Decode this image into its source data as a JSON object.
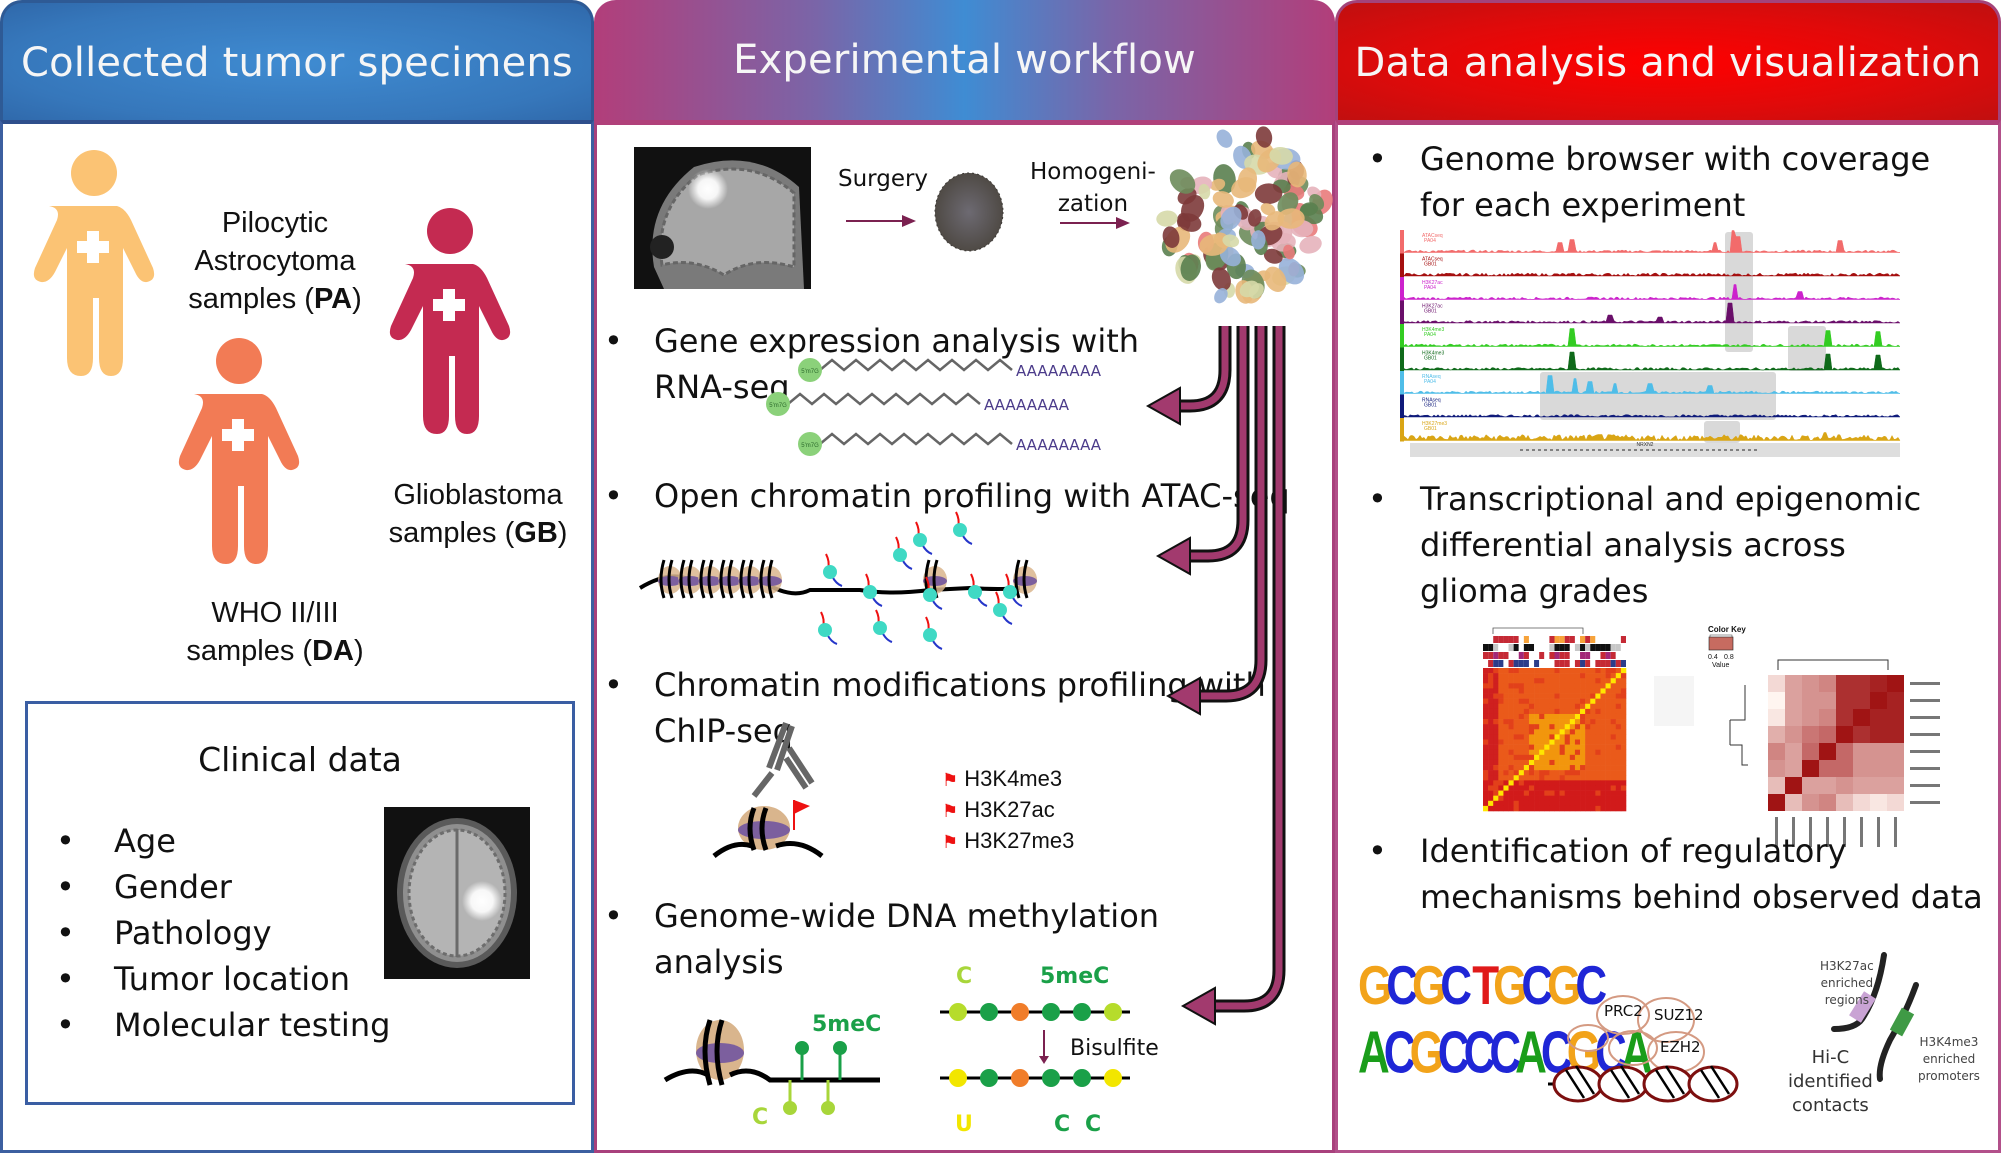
{
  "panels": {
    "specimens": {
      "title": "Collected tumor specimens",
      "groups": [
        {
          "line1": "Pilocytic",
          "line2": "Astrocytoma",
          "line3_prefix": "samples (",
          "code": "PA",
          "line3_suffix": ")",
          "color": "#fbc374"
        },
        {
          "line1": "WHO II/III",
          "line2_prefix": "samples (",
          "code": "DA",
          "line2_suffix": ")",
          "color": "#f27b55"
        },
        {
          "line1": "Glioblastoma",
          "line2_prefix": "samples (",
          "code": "GB",
          "line2_suffix": ")",
          "color": "#c42a51"
        }
      ],
      "clinical": {
        "title": "Clinical data",
        "bullet": "•",
        "items": [
          "Age",
          "Gender",
          "Pathology",
          "Tumor location",
          "Molecular testing"
        ]
      }
    },
    "workflow": {
      "title": "Experimental workflow",
      "steps": {
        "surgery": "Surgery",
        "homog_1": "Homogeni-",
        "homog_2": "zation"
      },
      "bullet": "•",
      "rna": {
        "line1": "Gene expression analysis with",
        "line2": "RNA-seq",
        "cap": "5'm7G",
        "tail": "AAAAAAAA"
      },
      "atac": {
        "line1": "Open chromatin profiling with ATAC-seq"
      },
      "chip": {
        "line1": "Chromatin modifications profiling with",
        "line2": "ChIP-seq",
        "marks": [
          "H3K4me3",
          "H3K27ac",
          "H3K27me3"
        ]
      },
      "meth": {
        "line1": "Genome-wide DNA methylation",
        "line2": "analysis",
        "label_5mec": "5meC",
        "label_c": "C",
        "label_u": "U",
        "label_bisulfite": "Bisulfite",
        "label_cc1": "C",
        "label_cc2": "C"
      }
    },
    "analysis": {
      "title": "Data analysis and visualization",
      "bullet": "•",
      "items": [
        {
          "line1": "Genome browser with coverage",
          "line2": "for each experiment"
        },
        {
          "line1": "Transcriptional and epigenomic",
          "line2": "differential analysis across",
          "line3": "glioma grades"
        },
        {
          "line1": "Identification of regulatory",
          "line2": "mechanisms behind observed data"
        }
      ],
      "browser_tracks": [
        {
          "name": "ATACseq",
          "sample": "PA04",
          "color": "#f26b6b"
        },
        {
          "name": "ATACseq",
          "sample": "GB01",
          "color": "#a50f0f"
        },
        {
          "name": "H3K27ac",
          "sample": "PA04",
          "color": "#cc22cc"
        },
        {
          "name": "H3K27ac",
          "sample": "GB01",
          "color": "#6a0f6a"
        },
        {
          "name": "H3K4me3",
          "sample": "PA04",
          "color": "#33cc22"
        },
        {
          "name": "H3K4me3",
          "sample": "GB01",
          "color": "#0f6a1a"
        },
        {
          "name": "RNAseq",
          "sample": "PA04",
          "color": "#4fbde8"
        },
        {
          "name": "RNAseq",
          "sample": "GB01",
          "color": "#0f1a7a"
        },
        {
          "name": "H3K27me3",
          "sample": "GB01",
          "color": "#d9a515"
        }
      ],
      "gene_label": "NRXN2",
      "color_key": {
        "title": "Color Key",
        "ticks": [
          "0.4",
          "0.8"
        ],
        "label": "Value"
      },
      "motif_rows": [
        "GCGC TGCGC",
        "ACGCCCACGCA"
      ],
      "prc2": {
        "complex": "PRC2",
        "sub1": "SUZ12",
        "sub2": "EZH2"
      },
      "hic": {
        "label1": "Hi-C",
        "label2": "identified",
        "label3": "contacts",
        "k27_1": "H3K27ac",
        "k27_2": "enriched",
        "k27_3": "regions",
        "k4_1": "H3K4me3",
        "k4_2": "enriched",
        "k4_3": "promoters"
      }
    }
  }
}
